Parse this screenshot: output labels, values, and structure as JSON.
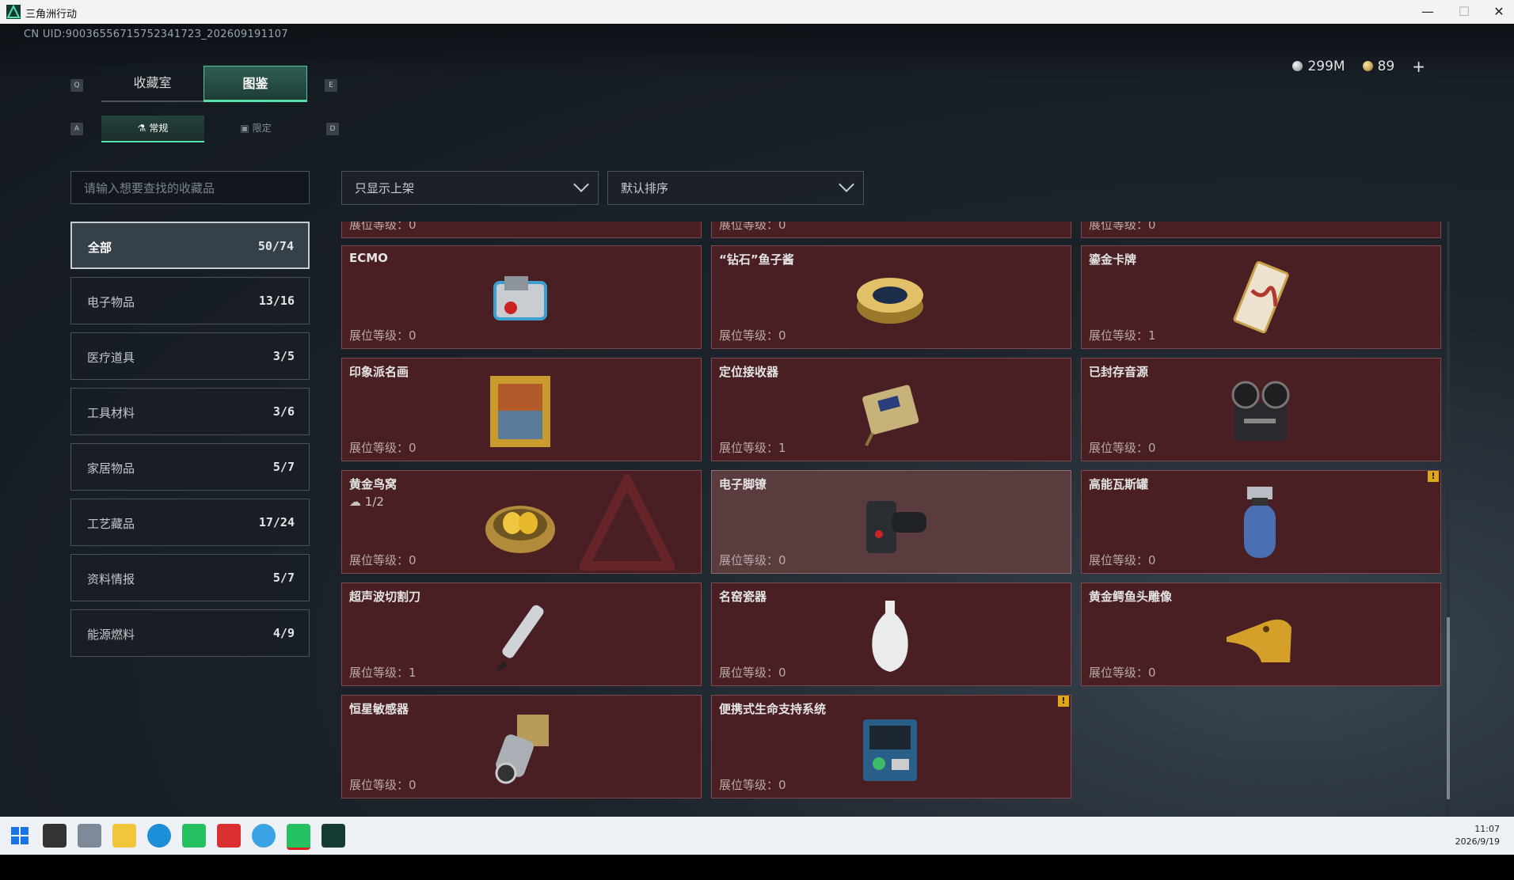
{
  "window": {
    "title": "三角洲行动",
    "minimize": "—",
    "maximize": "☐",
    "close": "✕"
  },
  "header": {
    "uid": "CN UID:9003655671575234172З_202609191107",
    "currency": [
      {
        "icon": "silver-coin-icon",
        "value": "299M"
      },
      {
        "icon": "gold-coin-icon",
        "value": "89"
      }
    ],
    "add_label": "+"
  },
  "keys": {
    "q": "Q",
    "e": "E",
    "a": "A",
    "d": "D"
  },
  "tabs": {
    "collection": "收藏室",
    "catalog": "图鉴"
  },
  "subtabs": {
    "regular": "常规",
    "limited": "限定"
  },
  "search": {
    "placeholder": "请输入想要查找的收藏品"
  },
  "filters": {
    "show": "只显示上架",
    "sort": "默认排序"
  },
  "categories": [
    {
      "name": "全部",
      "count": "50/74"
    },
    {
      "name": "电子物品",
      "count": "13/16"
    },
    {
      "name": "医疗道具",
      "count": "3/5"
    },
    {
      "name": "工具材料",
      "count": "3/6"
    },
    {
      "name": "家居物品",
      "count": "5/7"
    },
    {
      "name": "工艺藏品",
      "count": "17/24"
    },
    {
      "name": "资料情报",
      "count": "5/7"
    },
    {
      "name": "能源燃料",
      "count": "4/9"
    }
  ],
  "level_prefix": "展位等级：",
  "partial_row": [
    "0",
    "0",
    "0"
  ],
  "items": [
    {
      "name": "ECMO",
      "level": "0",
      "icon": "ecmo-machine-icon"
    },
    {
      "name": "“钻石”鱼子酱",
      "level": "0",
      "icon": "caviar-tin-icon"
    },
    {
      "name": "鎏金卡牌",
      "level": "1",
      "icon": "gilded-card-icon"
    },
    {
      "name": "印象派名画",
      "level": "0",
      "icon": "framed-painting-icon"
    },
    {
      "name": "定位接收器",
      "level": "1",
      "icon": "locator-receiver-icon"
    },
    {
      "name": "已封存音源",
      "level": "0",
      "icon": "reel-recorder-icon"
    },
    {
      "name": "黄金鸟窝",
      "level": "0",
      "icon": "golden-nest-icon",
      "progress": "1/2"
    },
    {
      "name": "电子脚镣",
      "level": "0",
      "icon": "ankle-monitor-icon"
    },
    {
      "name": "高能瓦斯罐",
      "level": "0",
      "icon": "gas-canister-icon",
      "warning": "!"
    },
    {
      "name": "超声波切割刀",
      "level": "1",
      "icon": "ultrasonic-cutter-icon"
    },
    {
      "name": "名窑瓷器",
      "level": "0",
      "icon": "porcelain-vase-icon"
    },
    {
      "name": "黄金鳄鱼头雕像",
      "level": "0",
      "icon": "gold-crocodile-icon"
    },
    {
      "name": "恒星敏感器",
      "level": "0",
      "icon": "star-sensor-icon"
    },
    {
      "name": "便携式生命支持系统",
      "level": "0",
      "icon": "life-support-icon",
      "warning": "!"
    }
  ],
  "taskbar": {
    "time": "11:07",
    "date": "2026/9/19"
  }
}
